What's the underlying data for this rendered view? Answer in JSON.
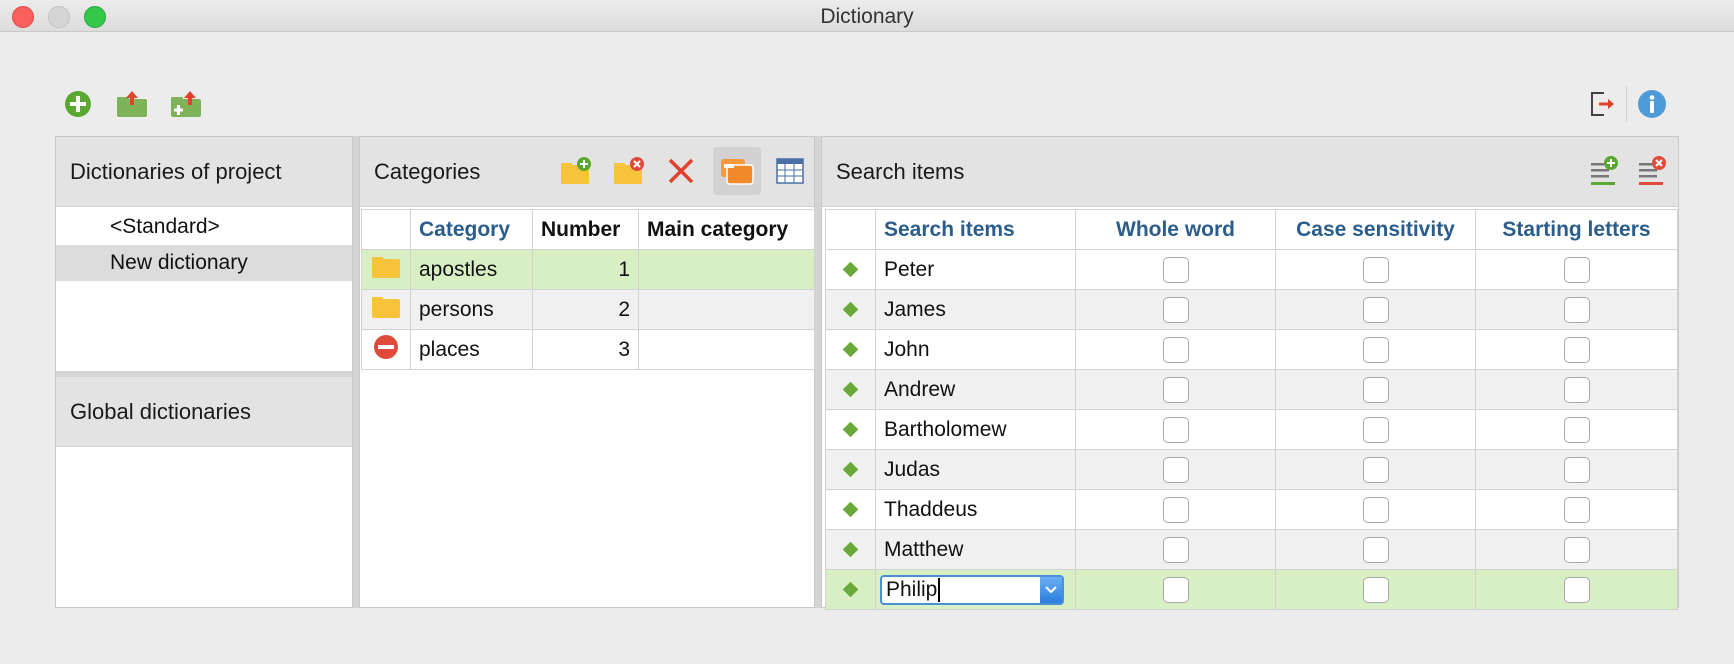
{
  "window": {
    "title": "Dictionary"
  },
  "toolbar": {
    "icons": [
      "add-dictionary-icon",
      "export-icon",
      "import-icon",
      "exit-icon",
      "info-icon"
    ]
  },
  "dictionaries_panel": {
    "title": "Dictionaries of project",
    "items": [
      {
        "label": "<Standard>"
      },
      {
        "label": "New dictionary"
      }
    ],
    "global_title": "Global dictionaries"
  },
  "categories_panel": {
    "title": "Categories",
    "columns": [
      "Category",
      "Number",
      "Main category"
    ],
    "rows": [
      {
        "icon": "folder-icon",
        "category": "apostles",
        "number": "1",
        "main": ""
      },
      {
        "icon": "folder-icon",
        "category": "persons",
        "number": "2",
        "main": ""
      },
      {
        "icon": "no-entry-icon",
        "category": "places",
        "number": "3",
        "main": ""
      }
    ]
  },
  "search_panel": {
    "title": "Search items",
    "columns": [
      "Search items",
      "Whole word",
      "Case sensitivity",
      "Starting letters"
    ],
    "rows": [
      {
        "name": "Peter"
      },
      {
        "name": "James"
      },
      {
        "name": "John"
      },
      {
        "name": "Andrew"
      },
      {
        "name": "Bartholomew"
      },
      {
        "name": "Judas"
      },
      {
        "name": "Thaddeus"
      },
      {
        "name": "Matthew"
      }
    ],
    "editing_value": "Philip"
  },
  "colors": {
    "accent_blue": "#2a5d8c",
    "highlight_green": "#d8efc4",
    "diamond_green": "#6aaa3a"
  }
}
